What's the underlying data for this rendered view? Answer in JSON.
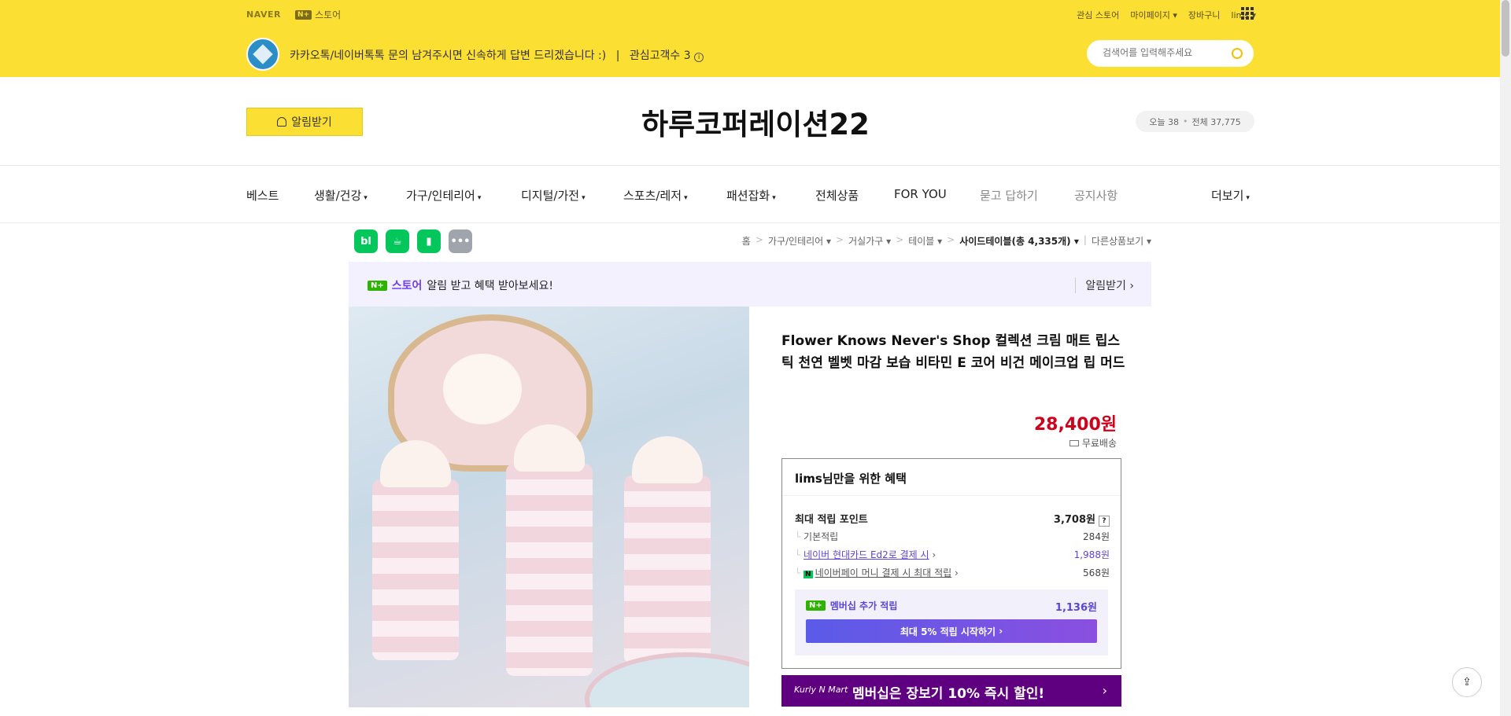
{
  "top": {
    "naver_logo": "NAVER",
    "nstore_badge": "N+",
    "nstore_label": "스토어",
    "links": [
      "관심 스토어",
      "마이페이지",
      "장바구니",
      "lims"
    ],
    "notice": "카카오톡/네이버톡톡 문의 남겨주시면 신속하게 답변 드리겠습니다 :)",
    "interest_customers": "관심고객수 3",
    "search_placeholder": "검색어를 입력해주세요"
  },
  "header": {
    "alarm_label": "알림받기",
    "store_title": "하루코퍼레이션22",
    "today_label": "오늘 38",
    "total_label": "전체 37,775"
  },
  "categories": [
    "베스트",
    "생활/건강",
    "가구/인테리어",
    "디지털/가전",
    "스포츠/레저",
    "패션잡화",
    "전체상품",
    "FOR YOU",
    "묻고 답하기",
    "공지사항",
    "더보기"
  ],
  "share_icons": [
    {
      "label": "bl",
      "color": "#03c75a",
      "icon": "blog-icon"
    },
    {
      "label": "☕",
      "color": "#03c75a",
      "icon": "cafe-icon"
    },
    {
      "label": "▮",
      "color": "#03c75a",
      "icon": "bookmark-icon"
    },
    {
      "label": "•••",
      "color": "#a0a4ad",
      "icon": "more-icon"
    }
  ],
  "breadcrumb": {
    "home": "홈",
    "c1": "가구/인테리어",
    "c2": "거실가구",
    "c3": "테이블",
    "current": "사이드테이블(총 4,335개)",
    "other": "다른상품보기"
  },
  "promo": {
    "badge": "N+",
    "store": "스토어",
    "text": "알림 받고 혜택 받아보세요!",
    "right": "알림받기"
  },
  "product": {
    "title": "Flower Knows Never's Shop 컬렉션 크림 매트 립스틱 천연 벨벳 마감 보습 비타민 E 코어 비건 메이크업 립 머드",
    "price": "28,400원",
    "shipping": "무료배송"
  },
  "benefit": {
    "title": "lims님만을 위한 혜택",
    "max_point_label": "최대 적립 포인트",
    "max_point_value": "3,708원",
    "basic_label": "기본적립",
    "basic_value": "284원",
    "card_label": "네이버 현대카드 Ed2로 결제 시",
    "card_value": "1,988원",
    "pay_label": "네이버페이 머니 결제 시 최대 적립",
    "pay_value": "568원",
    "member_label": "멤버십 추가 적립",
    "member_value": "1,136원",
    "member_button": "최대 5% 적립 시작하기"
  },
  "kurly": {
    "logo": "Kurly N Mart",
    "text": "멤버십은 장보기 10% 즉시 할인!"
  },
  "colors": {
    "brand_yellow": "#fcdf33",
    "price_red": "#d0021b",
    "naver_purple": "#5a46d6",
    "kurly_purple": "#5f0080"
  }
}
